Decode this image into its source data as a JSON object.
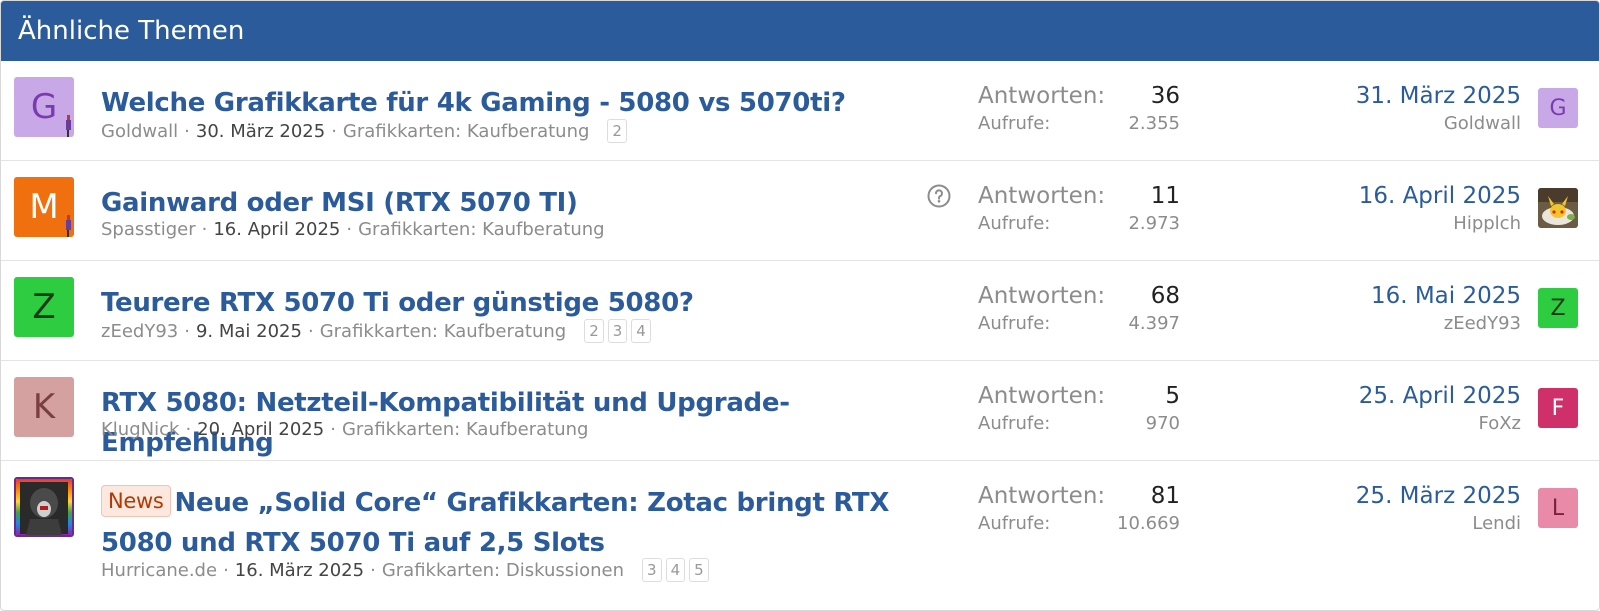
{
  "block": {
    "title": "Ähnliche Themen"
  },
  "threads": [
    {
      "avatar_letter": "G",
      "title": "Welche Grafikkarte für 4k Gaming - 5080 vs 5070ti?",
      "author": "Goldwall",
      "date": "30. März 2025",
      "forum": "Grafikkarten: Kaufberatung",
      "pages": [
        "2"
      ],
      "replies_label": "Antworten:",
      "replies": "36",
      "views_label": "Aufrufe:",
      "views": "2.355",
      "last_date": "31. März 2025",
      "last_user": "Goldwall",
      "last_avatar_letter": "G"
    },
    {
      "avatar_letter": "M",
      "title": "Gainward oder MSI (RTX 5070 TI)",
      "author": "Spasstiger",
      "date": "16. April 2025",
      "forum": "Grafikkarten: Kaufberatung",
      "pages": [],
      "replies_label": "Antworten:",
      "replies": "11",
      "views_label": "Aufrufe:",
      "views": "2.973",
      "last_date": "16. April 2025",
      "last_user": "Hipplch",
      "question_icon": "question-circle-icon"
    },
    {
      "avatar_letter": "Z",
      "title": "Teurere RTX 5070 Ti oder günstige 5080?",
      "author": "zEedY93",
      "date": "9. Mai 2025",
      "forum": "Grafikkarten: Kaufberatung",
      "pages": [
        "2",
        "3",
        "4"
      ],
      "replies_label": "Antworten:",
      "replies": "68",
      "views_label": "Aufrufe:",
      "views": "4.397",
      "last_date": "16. Mai 2025",
      "last_user": "zEedY93",
      "last_avatar_letter": "Z"
    },
    {
      "avatar_letter": "K",
      "title": "RTX 5080: Netzteil-Kompatibilität und Upgrade-Empfehlung",
      "author": "KlugNick",
      "date": "20. April 2025",
      "forum": "Grafikkarten: Kaufberatung",
      "pages": [],
      "replies_label": "Antworten:",
      "replies": "5",
      "views_label": "Aufrufe:",
      "views": "970",
      "last_date": "25. April 2025",
      "last_user": "FoXz",
      "last_avatar_letter": "F"
    },
    {
      "prefix": "News",
      "title": "Neue „Solid Core“ Grafikkarten: Zotac bringt RTX 5080 und RTX 5070 Ti auf 2,5 Slots",
      "author": "Hurricane.de",
      "date": "16. März 2025",
      "forum": "Grafikkarten: Diskussionen",
      "pages": [
        "3",
        "4",
        "5"
      ],
      "replies_label": "Antworten:",
      "replies": "81",
      "views_label": "Aufrufe:",
      "views": "10.669",
      "last_date": "25. März 2025",
      "last_user": "Lendi",
      "last_avatar_letter": "L"
    }
  ],
  "colors": {
    "header_bg": "#2b5b9b",
    "link": "#2b5b9b",
    "avatar_g": "#c9a8e8",
    "avatar_m": "#f07010",
    "avatar_z": "#2ecc40",
    "avatar_k": "#d4a0a0",
    "avatar_f": "#d0306a",
    "avatar_l": "#e88aa8"
  }
}
